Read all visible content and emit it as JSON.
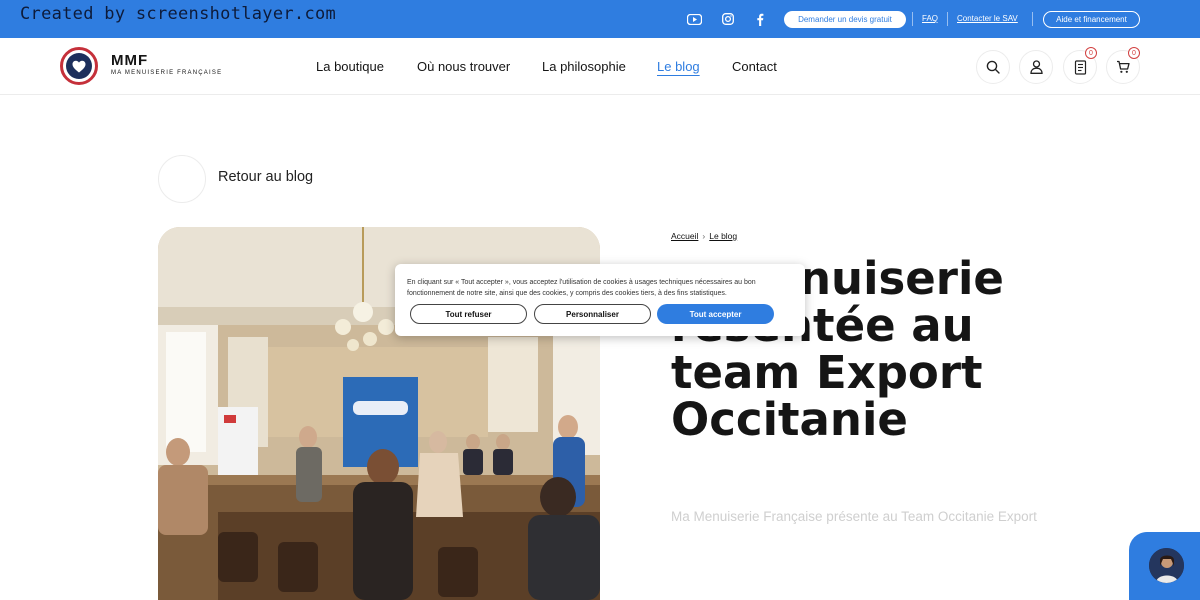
{
  "watermark": "Created by screenshotlayer.com",
  "topbar": {
    "social_icons": [
      "youtube-icon",
      "instagram-icon",
      "facebook-icon"
    ],
    "quote_button": "Demander un devis gratuit",
    "faq": "FAQ",
    "sav": "Contacter le SAV",
    "aid_button": "Aide et financement"
  },
  "header": {
    "logo": {
      "big": "MMF",
      "small": "MA MENUISERIE FRANÇAISE"
    },
    "nav": [
      "La boutique",
      "Où nous trouver",
      "La philosophie",
      "Le blog",
      "Contact"
    ],
    "active_nav": "Le blog",
    "icons": [
      "search-icon",
      "user-icon",
      "quote-list-icon",
      "cart-icon"
    ],
    "quote_count": "0",
    "cart_count": "0"
  },
  "content": {
    "back_label": "Retour au blog",
    "breadcrumb": [
      "Accueil",
      "Le blog"
    ],
    "title": "…nuiserie …résentée au team Export Occitanie",
    "title_lines": [
      "nuiserie",
      "résentée au",
      "team Export",
      "Occitanie"
    ],
    "subtitle": "Ma Menuiserie Française présente au Team Occitanie Export"
  },
  "cookie_banner": {
    "text": "En cliquant sur « Tout accepter », vous acceptez l'utilisation de cookies à usages techniques nécessaires au bon fonctionnement de notre site, ainsi que des cookies, y compris des cookies tiers, à des fins statistiques.",
    "refuse": "Tout refuser",
    "customize": "Personnaliser",
    "accept": "Tout accepter"
  },
  "colors": {
    "brand_blue": "#2f7de0",
    "logo_red": "#c5303a",
    "logo_navy": "#1d2f5c"
  }
}
